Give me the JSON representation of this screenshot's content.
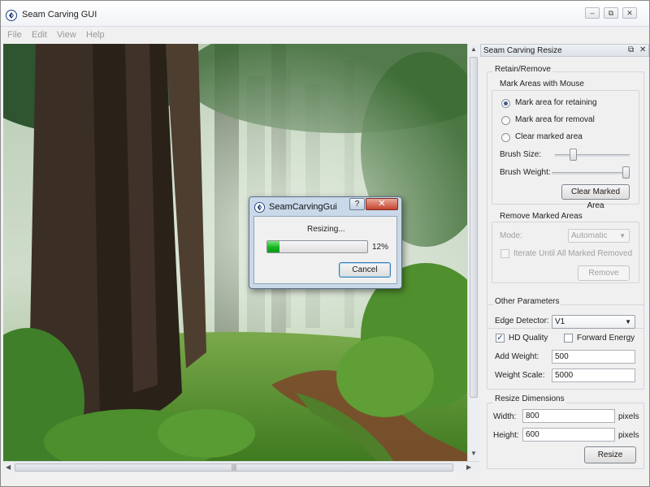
{
  "window": {
    "title": "Seam Carving GUI",
    "controls": [
      "minimize-icon",
      "restore-icon",
      "close-icon"
    ]
  },
  "menu": [
    "File",
    "Edit",
    "View",
    "Help"
  ],
  "canvas": {
    "image_description_icon": "forest-image"
  },
  "dock": {
    "title": "Seam Carving Resize",
    "retain_remove": {
      "title": "Retain/Remove",
      "mark_areas": {
        "title": "Mark Areas with Mouse",
        "options": [
          "Mark area for retaining",
          "Mark area for removal",
          "Clear marked area"
        ],
        "selected": "Mark area for retaining",
        "brush_size_label": "Brush Size:",
        "brush_weight_label": "Brush Weight:",
        "clear_button": "Clear Marked Area"
      },
      "remove_marked": {
        "title": "Remove Marked Areas",
        "mode_label": "Mode:",
        "mode_value": "Automatic",
        "iterate_label": "Iterate Until All Marked Removed",
        "remove_button": "Remove"
      }
    },
    "other_params": {
      "title": "Other Parameters",
      "edge_detector_label": "Edge Detector:",
      "edge_detector_value": "V1",
      "hd_quality_label": "HD Quality",
      "hd_quality_checked": true,
      "forward_energy_label": "Forward Energy",
      "forward_energy_checked": false,
      "add_weight_label": "Add Weight:",
      "add_weight_value": "500",
      "weight_scale_label": "Weight Scale:",
      "weight_scale_value": "5000"
    },
    "resize_dims": {
      "title": "Resize Dimensions",
      "width_label": "Width:",
      "width_value": "800",
      "height_label": "Height:",
      "height_value": "600",
      "unit": "pixels",
      "resize_button": "Resize"
    }
  },
  "dialog": {
    "title": "SeamCarvingGui",
    "help": "?",
    "close": "✕",
    "message": "Resizing...",
    "progress_fraction": 0.12,
    "progress_text": "12%",
    "cancel_button": "Cancel"
  },
  "colors": {
    "progress_green": "#13b51f",
    "dialog_frame": "#c9d9ea",
    "close_red": "#c7432e",
    "radio_accent": "#3e5f86"
  }
}
